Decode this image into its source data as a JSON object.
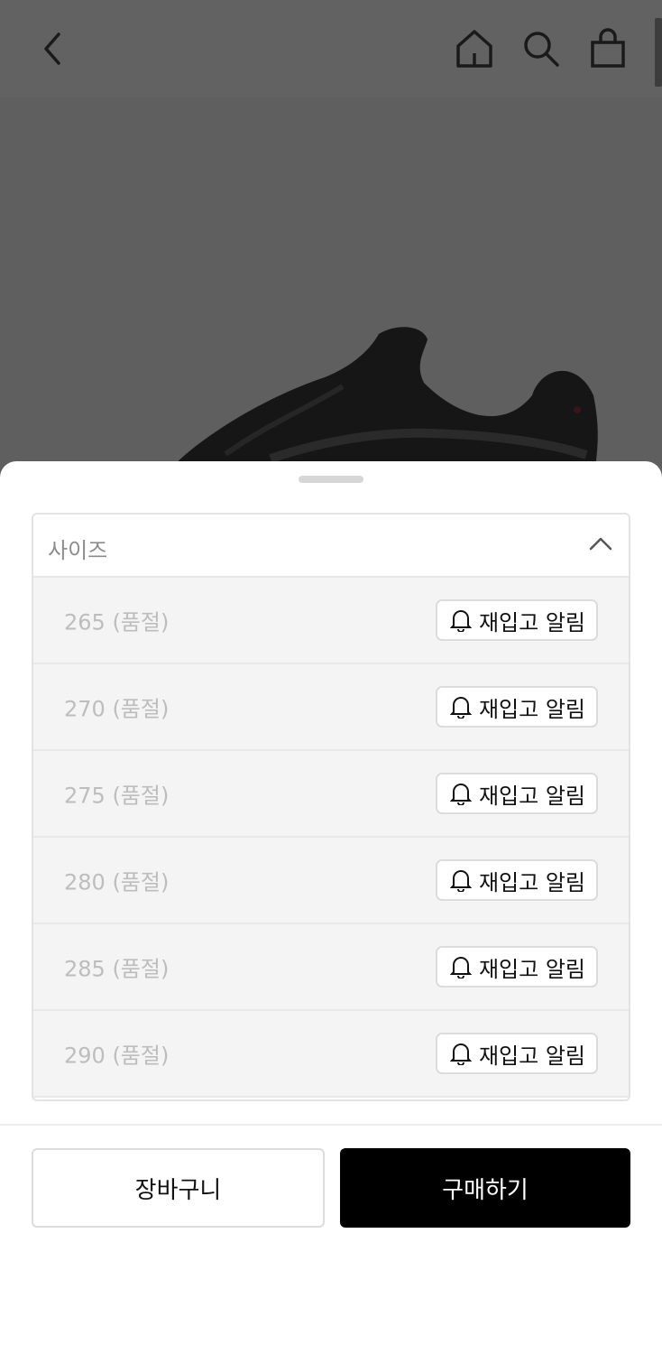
{
  "header": {
    "icons": [
      "chevron-left-icon",
      "home-icon",
      "search-icon",
      "bag-icon"
    ]
  },
  "sheet": {
    "select_label": "사이즈",
    "sizes": [
      {
        "label": "265 (품절)",
        "action": "재입고 알림"
      },
      {
        "label": "270 (품절)",
        "action": "재입고 알림"
      },
      {
        "label": "275 (품절)",
        "action": "재입고 알림"
      },
      {
        "label": "280 (품절)",
        "action": "재입고 알림"
      },
      {
        "label": "285 (품절)",
        "action": "재입고 알림"
      },
      {
        "label": "290 (품절)",
        "action": "재입고 알림"
      }
    ],
    "cart_label": "장바구니",
    "buy_label": "구매하기"
  },
  "colors": {
    "overlay": "#5c5c5c",
    "buy_button": "#000000",
    "sold_out_text": "#bdbdbd"
  }
}
